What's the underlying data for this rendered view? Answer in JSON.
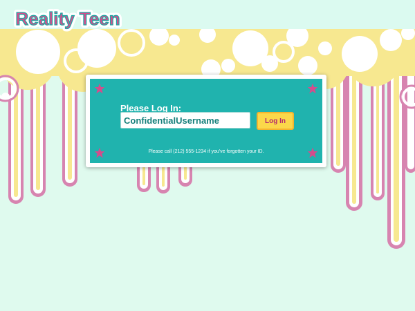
{
  "app": {
    "brand": "Reality Teen"
  },
  "login": {
    "heading": "Please Log In:",
    "username_value": "ConfidentialUsername",
    "submit_label": "Log In",
    "help_text": "Please call (212) 555-1234 if you've forgotten your ID."
  },
  "colors": {
    "background": "#dffaee",
    "panel": "#20b3ae",
    "accent_pink": "#d44d8c",
    "accent_yellow": "#fbd84a",
    "drip_pink": "#d784b0",
    "drip_yellow": "#f7e890"
  },
  "icons": {
    "corner_star": "star-icon"
  }
}
